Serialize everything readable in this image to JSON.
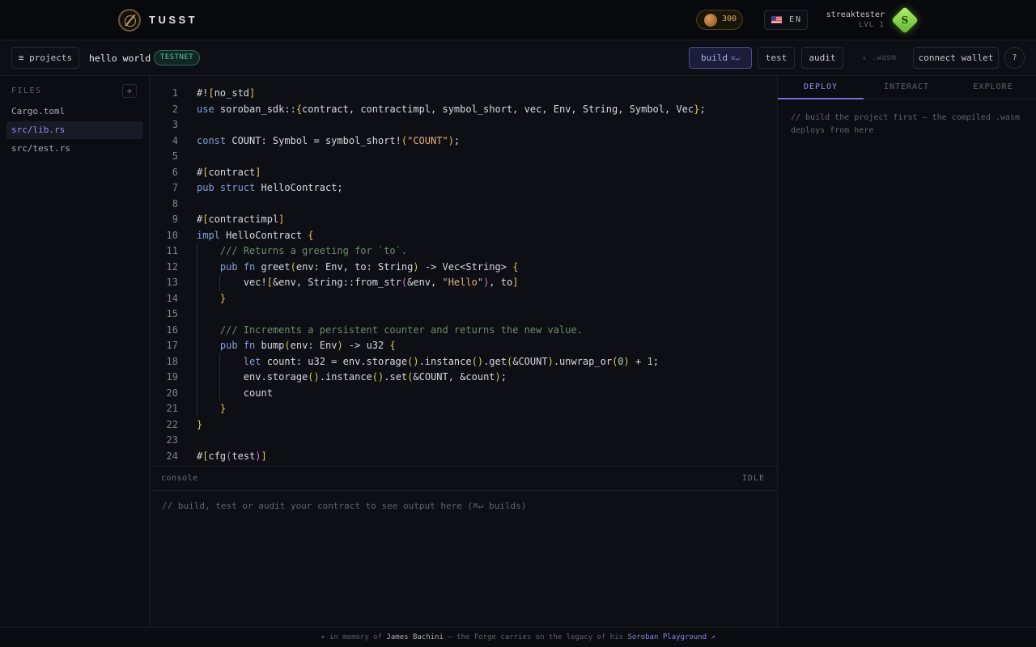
{
  "header": {
    "brand": "TUSST",
    "coins": "300",
    "language": "EN",
    "username": "streaktester",
    "level": "LVL 1",
    "avatar_letter": "S",
    "accent": "#8f90f0"
  },
  "toolbar": {
    "projects_label": "≡ projects",
    "project_name": "hello world",
    "network": "TESTNET",
    "build_label": "build",
    "build_shortcut": "⌘↵",
    "test_label": "test",
    "audit_label": "audit",
    "wasm_label": "↓ .wasm",
    "wallet_label": "connect wallet",
    "help_label": "?"
  },
  "sidebar": {
    "title": "FILES",
    "add_label": "+",
    "files": [
      "Cargo.toml",
      "src/lib.rs",
      "src/test.rs"
    ],
    "active_file": "src/lib.rs"
  },
  "editor": {
    "lines": [
      "#![no_std]",
      "use soroban_sdk::{contract, contractimpl, symbol_short, vec, Env, String, Symbol, Vec};",
      "",
      "const COUNT: Symbol = symbol_short!(\"COUNT\");",
      "",
      "#[contract]",
      "pub struct HelloContract;",
      "",
      "#[contractimpl]",
      "impl HelloContract {",
      "    /// Returns a greeting for `to`.",
      "    pub fn greet(env: Env, to: String) -> Vec<String> {",
      "        vec![&env, String::from_str(&env, \"Hello\"), to]",
      "    }",
      "",
      "    /// Increments a persistent counter and returns the new value.",
      "    pub fn bump(env: Env) -> u32 {",
      "        let count: u32 = env.storage().instance().get(&COUNT).unwrap_or(0) + 1;",
      "        env.storage().instance().set(&COUNT, &count);",
      "        count",
      "    }",
      "}",
      "",
      "#[cfg(test)]"
    ]
  },
  "console": {
    "title": "console",
    "status": "IDLE",
    "message": "// build, test or audit your contract to see output here (⌘↵ builds)"
  },
  "right_panel": {
    "tabs": [
      "DEPLOY",
      "INTERACT",
      "EXPLORE"
    ],
    "active_tab": "DEPLOY",
    "note": "// build the project first — the compiled .wasm deploys from here"
  },
  "footer": {
    "prefix": "✦ in memory of ",
    "name": "James Bachini",
    "middle": " — the Forge carries on the legacy of his ",
    "link": "Soroban Playground ↗"
  }
}
